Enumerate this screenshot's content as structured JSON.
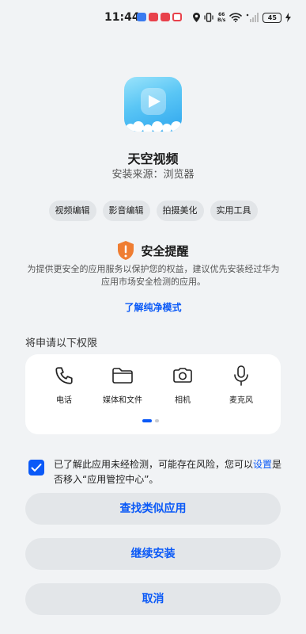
{
  "status_bar": {
    "time": "11:44",
    "notification_colors": [
      "#3a7bf0",
      "#e8414b",
      "#e8414b",
      "#e8414b"
    ],
    "net_speed_top": "66",
    "net_speed_bottom": "B/s",
    "battery": "45"
  },
  "app": {
    "name": "天空视频",
    "source": "安装来源：浏览器",
    "tags": [
      "视频编辑",
      "影音编辑",
      "拍摄美化",
      "实用工具"
    ]
  },
  "security": {
    "title": "安全提醒",
    "description": "为提供更安全的应用服务以保护您的权益，建议优先安装经过华为应用市场安全检测的应用。",
    "link": "了解纯净模式",
    "icon": "warning-shield-icon",
    "color": "#ef7d32"
  },
  "permissions": {
    "heading": "将申请以下权限",
    "items": [
      {
        "label": "电话",
        "icon": "phone-icon"
      },
      {
        "label": "媒体和文件",
        "icon": "folder-icon"
      },
      {
        "label": "相机",
        "icon": "camera-icon"
      },
      {
        "label": "麦克风",
        "icon": "microphone-icon"
      }
    ],
    "page_indicator": {
      "pages": 2,
      "current": 1
    }
  },
  "consent": {
    "checked": true,
    "text_before": "已了解此应用未经检测，可能存在风险，您可以",
    "link": "设置",
    "text_after": "是否移入“应用管控中心”。"
  },
  "buttons": {
    "find_similar": "查找类似应用",
    "continue": "继续安装",
    "cancel": "取消"
  },
  "colors": {
    "accent": "#0a59f7",
    "background": "#f1f3f5"
  }
}
